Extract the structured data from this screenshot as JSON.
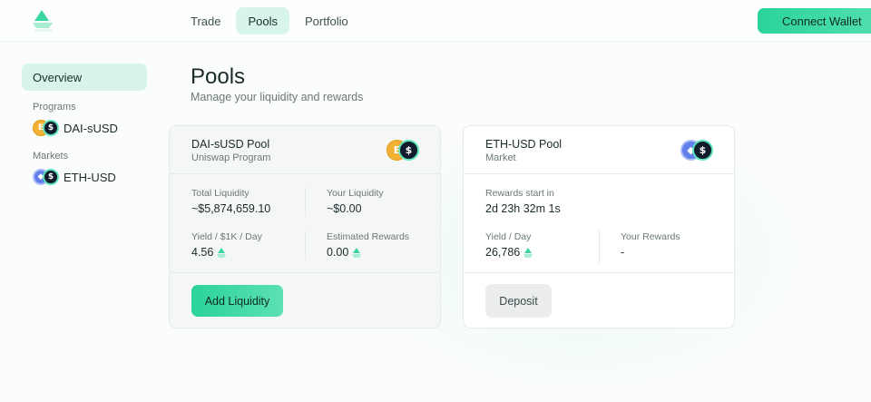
{
  "header": {
    "nav": [
      "Trade",
      "Pools",
      "Portfolio"
    ],
    "active_nav": "Pools",
    "connect_label": "Connect Wallet"
  },
  "sidebar": {
    "overview_label": "Overview",
    "programs_title": "Programs",
    "program_item": "DAI-sUSD",
    "markets_title": "Markets",
    "market_item": "ETH-USD"
  },
  "main": {
    "title": "Pools",
    "subtitle": "Manage your liquidity and rewards"
  },
  "pools": [
    {
      "title": "DAI-sUSD Pool",
      "subtitle": "Uniswap Program",
      "coins": [
        "dai-coin-icon",
        "susd-coin-icon"
      ],
      "stats": [
        {
          "label": "Total Liquidity",
          "value": "~$5,874,659.10",
          "token": false
        },
        {
          "label": "Your Liquidity",
          "value": "~$0.00",
          "token": false
        },
        {
          "label": "Yield / $1K / Day",
          "value": "4.56",
          "token": true
        },
        {
          "label": "Estimated Rewards",
          "value": "0.00",
          "token": true
        }
      ],
      "action": "Add Liquidity"
    },
    {
      "title": "ETH-USD Pool",
      "subtitle": "Market",
      "coins": [
        "eth-coin-icon",
        "susd-coin-icon"
      ],
      "stats": [
        {
          "label": "Rewards start in",
          "value": "2d 23h 32m 1s",
          "token": false
        },
        {
          "label": "Yield / Day",
          "value": "26,786",
          "token": true
        },
        {
          "label": "Your Rewards",
          "value": "-",
          "token": false
        }
      ],
      "action": "Deposit"
    }
  ],
  "icons": {
    "logo": "leaf-logo-icon",
    "token": "leaf-token-icon",
    "dai_glyph": "E",
    "usd_glyph": "$",
    "eth_glyph": "◆"
  },
  "colors": {
    "accent": "#2bd39a",
    "accent_light": "#d8f5ec",
    "dai": "#f2b035",
    "eth": "#627eea",
    "usd": "#101b2c"
  }
}
